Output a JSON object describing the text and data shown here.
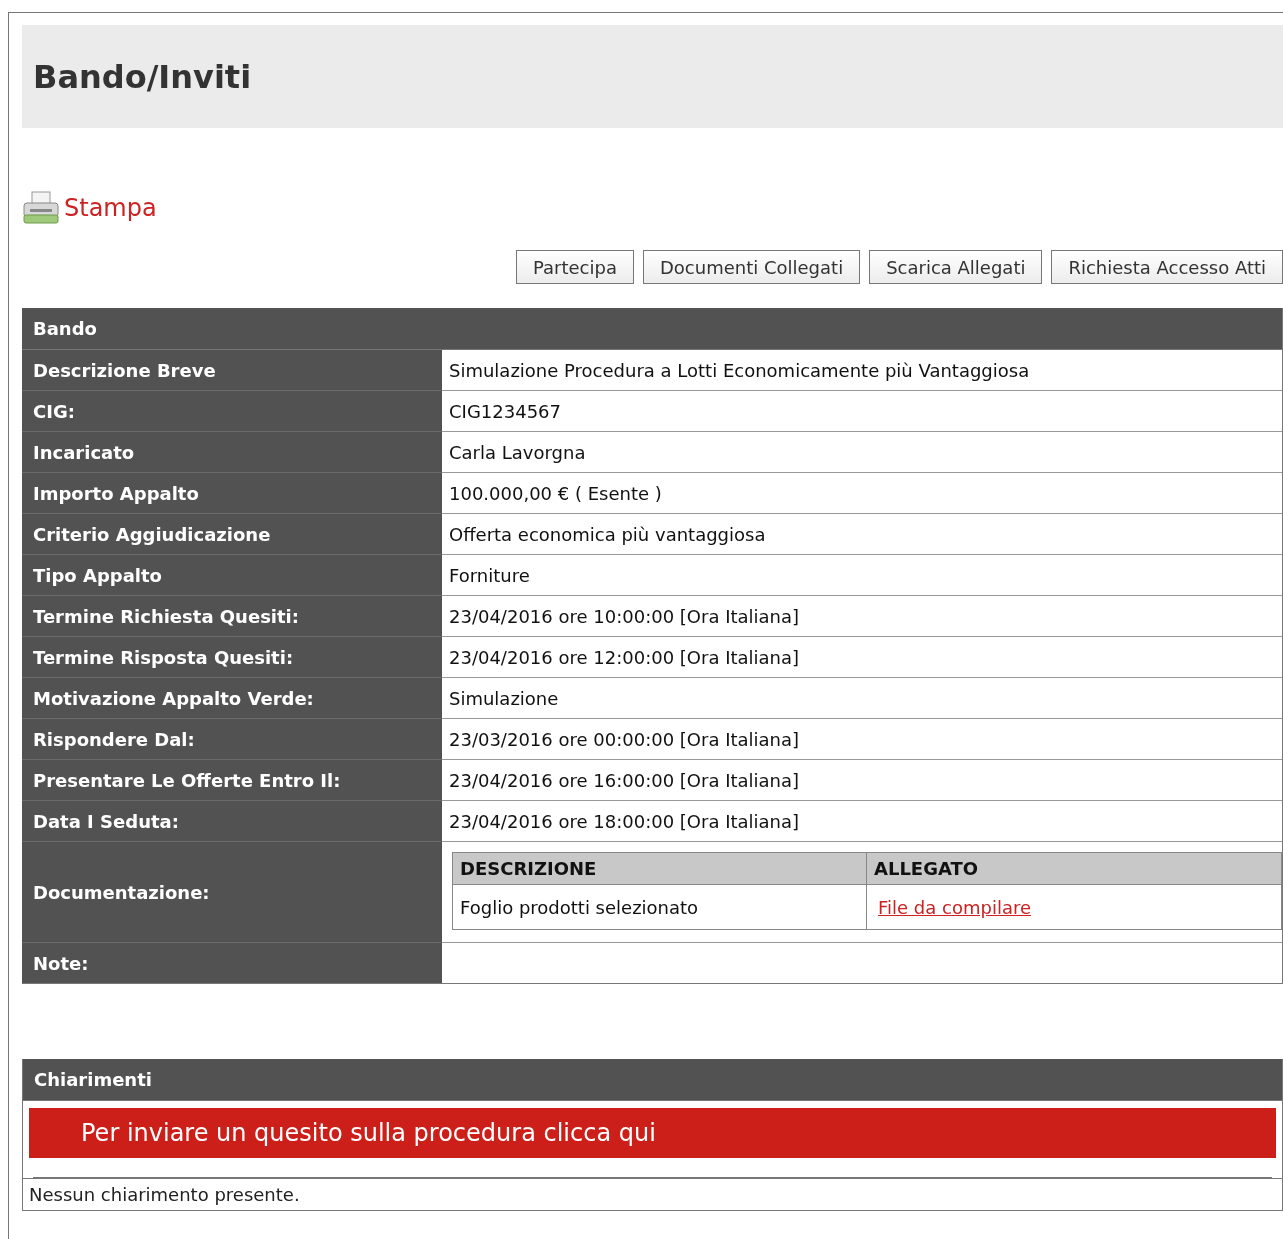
{
  "title": "Bando/Inviti",
  "print_link": "Stampa",
  "buttons": [
    "Partecipa",
    "Documenti Collegati",
    "Scarica Allegati",
    "Richiesta Accesso Atti"
  ],
  "bando": {
    "header": "Bando",
    "rows": [
      {
        "label": "Descrizione Breve",
        "value": "Simulazione Procedura a Lotti Economicamente più Vantaggiosa"
      },
      {
        "label": "CIG:",
        "value": "CIG1234567"
      },
      {
        "label": "Incaricato",
        "value": "Carla Lavorgna"
      },
      {
        "label": "Importo Appalto",
        "value": "100.000,00 € ( Esente )"
      },
      {
        "label": "Criterio Aggiudicazione",
        "value": "Offerta economica più vantaggiosa"
      },
      {
        "label": "Tipo Appalto",
        "value": "Forniture"
      },
      {
        "label": "Termine Richiesta Quesiti:",
        "value": "23/04/2016 ore 10:00:00 [Ora Italiana]"
      },
      {
        "label": "Termine Risposta Quesiti:",
        "value": "23/04/2016 ore 12:00:00 [Ora Italiana]"
      },
      {
        "label": "Motivazione Appalto Verde:",
        "value": "Simulazione"
      },
      {
        "label": "Rispondere Dal:",
        "value": "23/03/2016 ore 00:00:00 [Ora Italiana]"
      },
      {
        "label": "Presentare Le Offerte Entro Il:",
        "value": "23/04/2016 ore 16:00:00 [Ora Italiana]"
      },
      {
        "label": "Data I Seduta:",
        "value": "23/04/2016 ore 18:00:00 [Ora Italiana]"
      }
    ],
    "documentazione": {
      "label": "Documentazione:",
      "columns": [
        "DESCRIZIONE",
        "ALLEGATO"
      ],
      "rows": [
        {
          "descrizione": "Foglio prodotti selezionato",
          "allegato": "File da compilare"
        }
      ]
    },
    "note": {
      "label": "Note:"
    }
  },
  "chiarimenti": {
    "header": "Chiarimenti",
    "action": "Per inviare un quesito sulla procedura clicca qui",
    "message": "Nessun chiarimento presente."
  }
}
